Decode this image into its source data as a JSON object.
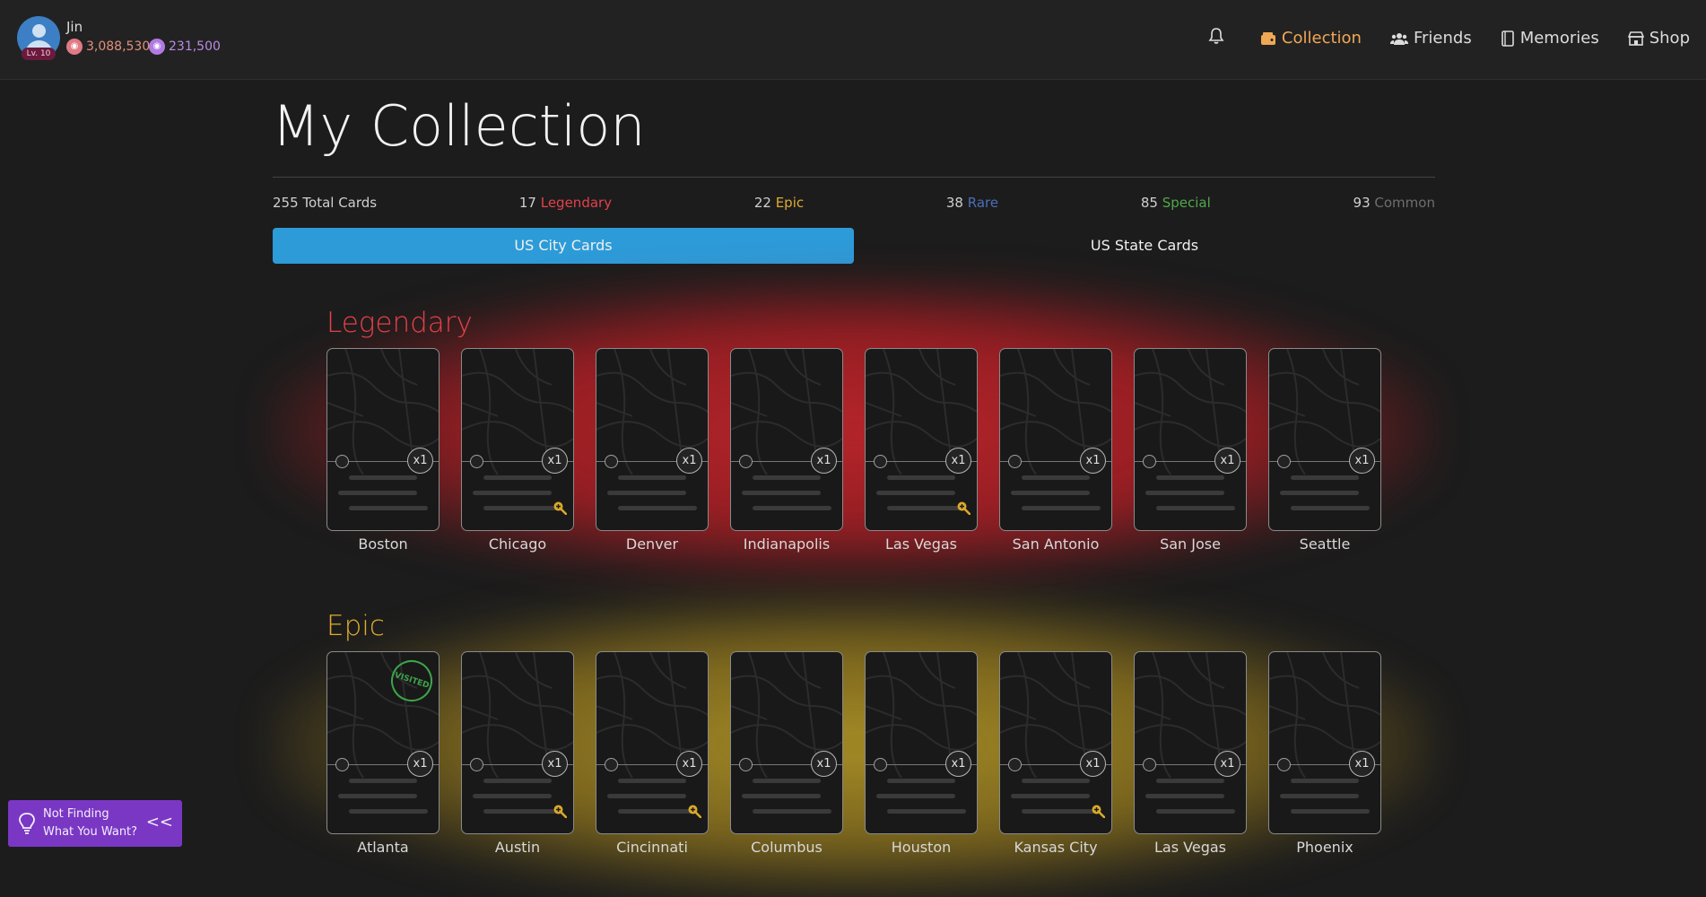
{
  "user": {
    "name": "Jin",
    "level": "Lv. 10",
    "coins_red": "3,088,530",
    "coins_purple": "231,500"
  },
  "nav": {
    "items": [
      {
        "label": "Collection",
        "icon": "wallet-icon",
        "active": true
      },
      {
        "label": "Friends",
        "icon": "users-icon"
      },
      {
        "label": "Memories",
        "icon": "book-icon"
      },
      {
        "label": "Shop",
        "icon": "store-icon"
      }
    ]
  },
  "page": {
    "title": "My Collection"
  },
  "stats": {
    "total": "255 Total Cards",
    "legendary_count": "17",
    "legendary_label": "Legendary",
    "epic_count": "22",
    "epic_label": "Epic",
    "rare_count": "38",
    "rare_label": "Rare",
    "special_count": "85",
    "special_label": "Special",
    "common_count": "93",
    "common_label": "Common"
  },
  "tabs": [
    "US City Cards",
    "US State Cards"
  ],
  "colors": {
    "legendary": "#e2424a",
    "epic": "#e0aa30",
    "rare": "#4a6fb8",
    "special": "#4fa84a",
    "common": "#6e6e6e",
    "accent": "#2d9bd8",
    "nav_active": "#f0a855"
  },
  "sections": [
    {
      "title": "Legendary",
      "cards": [
        {
          "name": "Boston",
          "count": "x1"
        },
        {
          "name": "Chicago",
          "count": "x1",
          "zoom": true
        },
        {
          "name": "Denver",
          "count": "x1"
        },
        {
          "name": "Indianapolis",
          "count": "x1"
        },
        {
          "name": "Las Vegas",
          "count": "x1",
          "zoom": true
        },
        {
          "name": "San Antonio",
          "count": "x1"
        },
        {
          "name": "San Jose",
          "count": "x1"
        },
        {
          "name": "Seattle",
          "count": "x1"
        }
      ]
    },
    {
      "title": "Epic",
      "cards": [
        {
          "name": "Atlanta",
          "count": "x1",
          "visited": true
        },
        {
          "name": "Austin",
          "count": "x1",
          "zoom": true
        },
        {
          "name": "Cincinnati",
          "count": "x1",
          "zoom": true
        },
        {
          "name": "Columbus",
          "count": "x1"
        },
        {
          "name": "Houston",
          "count": "x1"
        },
        {
          "name": "Kansas City",
          "count": "x1",
          "zoom": true
        },
        {
          "name": "Las Vegas",
          "count": "x1"
        },
        {
          "name": "Phoenix",
          "count": "x1"
        }
      ]
    }
  ],
  "stamp_label": "VISITED",
  "help": {
    "line1": "Not Finding",
    "line2": "What You Want?",
    "toggle": "<<"
  }
}
